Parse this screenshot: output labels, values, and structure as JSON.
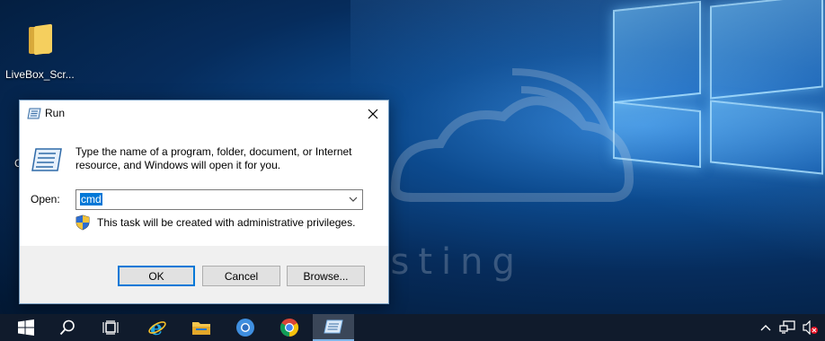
{
  "desktop": {
    "icons": [
      {
        "label": "LiveBox_Scr...",
        "icon": "folder-icon"
      }
    ],
    "partial_label": "C",
    "colors": {
      "wallpaper_dark": "#031833",
      "wallpaper_light": "#2f7fd0"
    }
  },
  "run_dialog": {
    "title": "Run",
    "description": "Type the name of a program, folder, document, or Internet resource, and Windows will open it for you.",
    "open_label": "Open:",
    "open_value": "cmd",
    "admin_note": "This task will be created with administrative privileges.",
    "buttons": {
      "ok": "OK",
      "cancel": "Cancel",
      "browse": "Browse..."
    },
    "colors": {
      "accent": "#0078d7",
      "footer_bg": "#f0f0f0"
    }
  },
  "taskbar": {
    "items": [
      {
        "name": "start",
        "icon": "windows-logo-icon"
      },
      {
        "name": "search",
        "icon": "search-icon"
      },
      {
        "name": "task-view",
        "icon": "task-view-icon"
      },
      {
        "name": "internet-explorer",
        "icon": "internet-explorer-icon"
      },
      {
        "name": "file-explorer",
        "icon": "folder-icon"
      },
      {
        "name": "chrome-blue",
        "icon": "chrome-icon"
      },
      {
        "name": "chrome",
        "icon": "chrome-icon"
      },
      {
        "name": "run",
        "icon": "run-icon",
        "active": true
      }
    ],
    "tray": [
      "chevron-up-icon",
      "network-icon",
      "volume-muted-icon"
    ]
  }
}
